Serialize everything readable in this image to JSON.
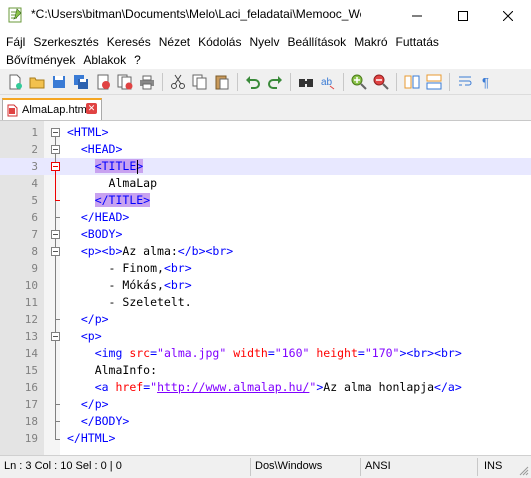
{
  "window": {
    "title": "*C:\\Users\\bitman\\Documents\\Melo\\Laci_feladatai\\Memooc_Web..."
  },
  "menu": {
    "row1": [
      "Fájl",
      "Szerkesztés",
      "Keresés",
      "Nézet",
      "Kódolás",
      "Nyelv",
      "Beállítások",
      "Makró",
      "Futtatás"
    ],
    "row2": [
      "Bővítmények",
      "Ablakok",
      "?"
    ]
  },
  "toolbar": {
    "buttons": [
      "new-file-icon",
      "open-file-icon",
      "save-icon",
      "save-all-icon",
      "close-icon",
      "close-all-icon",
      "print-icon",
      "cut-icon",
      "copy-icon",
      "paste-icon",
      "undo-icon",
      "redo-icon",
      "find-icon",
      "replace-icon",
      "zoom-in-icon",
      "zoom-out-icon",
      "sync-vertical-icon",
      "sync-horizontal-icon",
      "word-wrap-icon",
      "show-all-chars-icon"
    ]
  },
  "tab": {
    "label": "AlmaLap.htm"
  },
  "code": {
    "lines": [
      {
        "num": "1",
        "text": "<HTML>"
      },
      {
        "num": "2",
        "text": "  <HEAD>"
      },
      {
        "num": "3",
        "text": "    <TITLE>"
      },
      {
        "num": "4",
        "text": "      AlmaLap"
      },
      {
        "num": "5",
        "text": "    </TITLE>"
      },
      {
        "num": "6",
        "text": "  </HEAD>"
      },
      {
        "num": "7",
        "text": "  <BODY>"
      },
      {
        "num": "8",
        "text": "  <p><b>Az alma:</b><br>"
      },
      {
        "num": "9",
        "text": "      - Finom,<br>"
      },
      {
        "num": "10",
        "text": "      - Mókás,<br>"
      },
      {
        "num": "11",
        "text": "      - Szeletelt."
      },
      {
        "num": "12",
        "text": "  </p>"
      },
      {
        "num": "13",
        "text": "  <p>"
      },
      {
        "num": "14",
        "text": "    <img src=\"alma.jpg\" width=\"160\" height=\"170\"><br><br>"
      },
      {
        "num": "15",
        "text": "    AlmaInfo:"
      },
      {
        "num": "16",
        "text": "    <a href=\"http://www.almalap.hu/\">Az alma honlapja</a>"
      },
      {
        "num": "17",
        "text": "  </p>"
      },
      {
        "num": "18",
        "text": "  </BODY>"
      },
      {
        "num": "19",
        "text": "</HTML>"
      }
    ]
  },
  "status": {
    "position": "Ln : 3    Col : 10    Sel : 0 | 0",
    "eol": "Dos\\Windows",
    "encoding": "ANSI",
    "mode": "INS"
  },
  "colors": {
    "tag": "#0000ff",
    "attribute": "#ff0000",
    "value": "#8000ff",
    "tag_match_highlight": "#c8a2f0",
    "current_line": "#e8e8ff",
    "tab_accent": "#f5a623"
  }
}
